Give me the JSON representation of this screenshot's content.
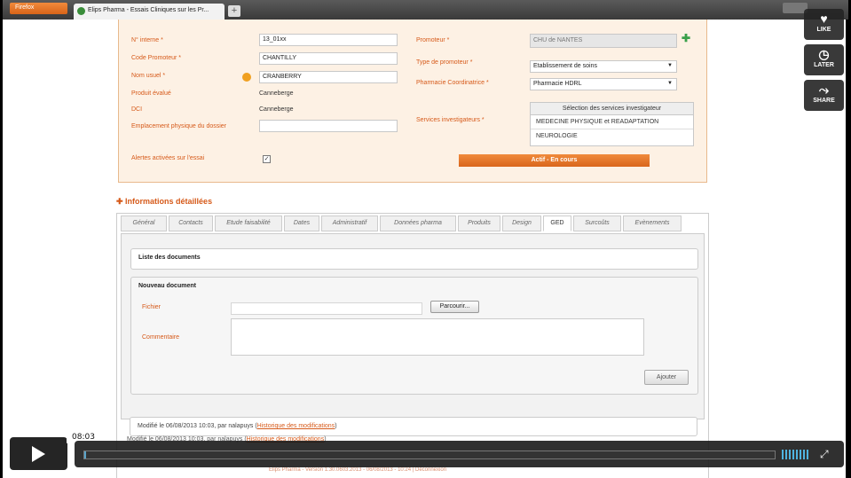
{
  "browser": {
    "menu_button": "Firefox",
    "tab_title": "Elips Pharma - Essais Cliniques sur les Pr...",
    "new_tab": "+"
  },
  "form": {
    "left_fields": [
      {
        "label": "N° interne *",
        "value": "13_01xx",
        "kind": "input"
      },
      {
        "label": "Code Promoteur *",
        "value": "CHANTILLY",
        "kind": "input"
      },
      {
        "label": "Nom usuel *",
        "value": "CRANBERRY",
        "kind": "input"
      },
      {
        "label": "Produit évalué",
        "value": "Canneberge",
        "kind": "text"
      },
      {
        "label": "DCI",
        "value": "Canneberge",
        "kind": "text"
      },
      {
        "label": "Emplacement physique du dossier",
        "value": "",
        "kind": "input"
      }
    ],
    "alerts_label": "Alertes activées sur l'essai",
    "alerts_checked": true,
    "promoteur_label": "Promoteur *",
    "promoteur_value": "CHU de NANTES",
    "type_promoteur_label": "Type de promoteur *",
    "type_promoteur_value": "Etablissement de soins",
    "pharmacie_label": "Pharmacie Coordinatrice *",
    "pharmacie_value": "Pharmacie HDRL",
    "services_label": "Services investigateurs *",
    "services_header": "Sélection des services investigateur",
    "services": [
      "MEDECINE PHYSIQUE et READAPTATION",
      "NEUROLOGIE"
    ],
    "status": "Actif - En cours"
  },
  "section_title": "Informations détaillées",
  "tabs": [
    "Général",
    "Contacts",
    "Etude faisabilité",
    "Dates",
    "Administratif",
    "Données pharma",
    "Produits",
    "Design",
    "GED",
    "Surcoûts",
    "Evènements"
  ],
  "active_tab": "GED",
  "ged": {
    "list_title": "Liste des documents",
    "new_doc_title": "Nouveau document",
    "file_label": "Fichier",
    "browse_label": "Parcourir...",
    "comment_label": "Commentaire",
    "add_label": "Ajouter",
    "modified_text": "Modifié le 06/08/2013 10:03, par nalapuys (",
    "history_link": "Historique des modifications",
    "modified_close": ")"
  },
  "bottom": {
    "modified_text": "Modifié le 06/08/2013 10:03, par nalapuys (",
    "history_link": "Historique des modifications",
    "modified_close": ")",
    "footer": "Elips Pharma - Version 1.30.0603.2013 - 06/08/2013 - 10:24 | Déconnexion"
  },
  "video": {
    "like": "LIKE",
    "later": "LATER",
    "share": "SHARE",
    "time": "08:03",
    "progress": 0.002
  }
}
